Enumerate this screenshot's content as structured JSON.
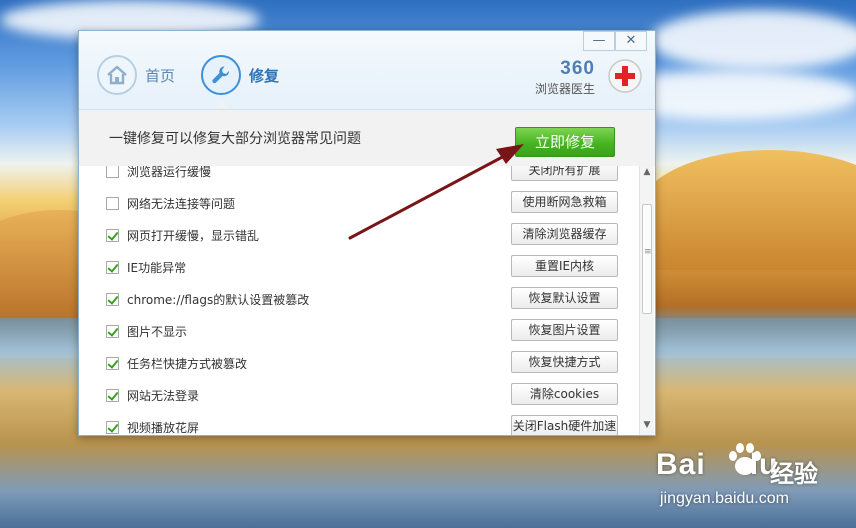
{
  "window": {
    "controls": {
      "minimize": "—",
      "close": "✕"
    },
    "nav": [
      {
        "label": "首页",
        "icon": "home-icon",
        "active": false
      },
      {
        "label": "修复",
        "icon": "wrench-icon",
        "active": true
      }
    ],
    "brand": {
      "number": "360",
      "subtitle": "浏览器医生",
      "icon": "first-aid-icon"
    }
  },
  "banner": {
    "text": "一键修复可以修复大部分浏览器常见问题",
    "fix_button": "立即修复"
  },
  "items": [
    {
      "label": "浏览器运行缓慢",
      "checked": false,
      "action": "关闭所有扩展"
    },
    {
      "label": "网络无法连接等问题",
      "checked": false,
      "action": "使用断网急救箱"
    },
    {
      "label": "网页打开缓慢，显示错乱",
      "checked": true,
      "action": "清除浏览器缓存"
    },
    {
      "label": "IE功能异常",
      "checked": true,
      "action": "重置IE内核"
    },
    {
      "label": "chrome://flags的默认设置被篡改",
      "checked": true,
      "action": "恢复默认设置"
    },
    {
      "label": "图片不显示",
      "checked": true,
      "action": "恢复图片设置"
    },
    {
      "label": "任务栏快捷方式被篡改",
      "checked": true,
      "action": "恢复快捷方式"
    },
    {
      "label": "网站无法登录",
      "checked": true,
      "action": "清除cookies"
    },
    {
      "label": "视频播放花屏",
      "checked": true,
      "action": "关闭Flash硬件加速"
    }
  ],
  "watermark": {
    "brand_left": "Bai",
    "brand_right": "du",
    "brand_cn": "经验",
    "url": "jingyan.baidu.com"
  },
  "colors": {
    "accent_blue": "#3d8fd8",
    "fix_green": "#47b423",
    "arrow": "#7a1517"
  }
}
